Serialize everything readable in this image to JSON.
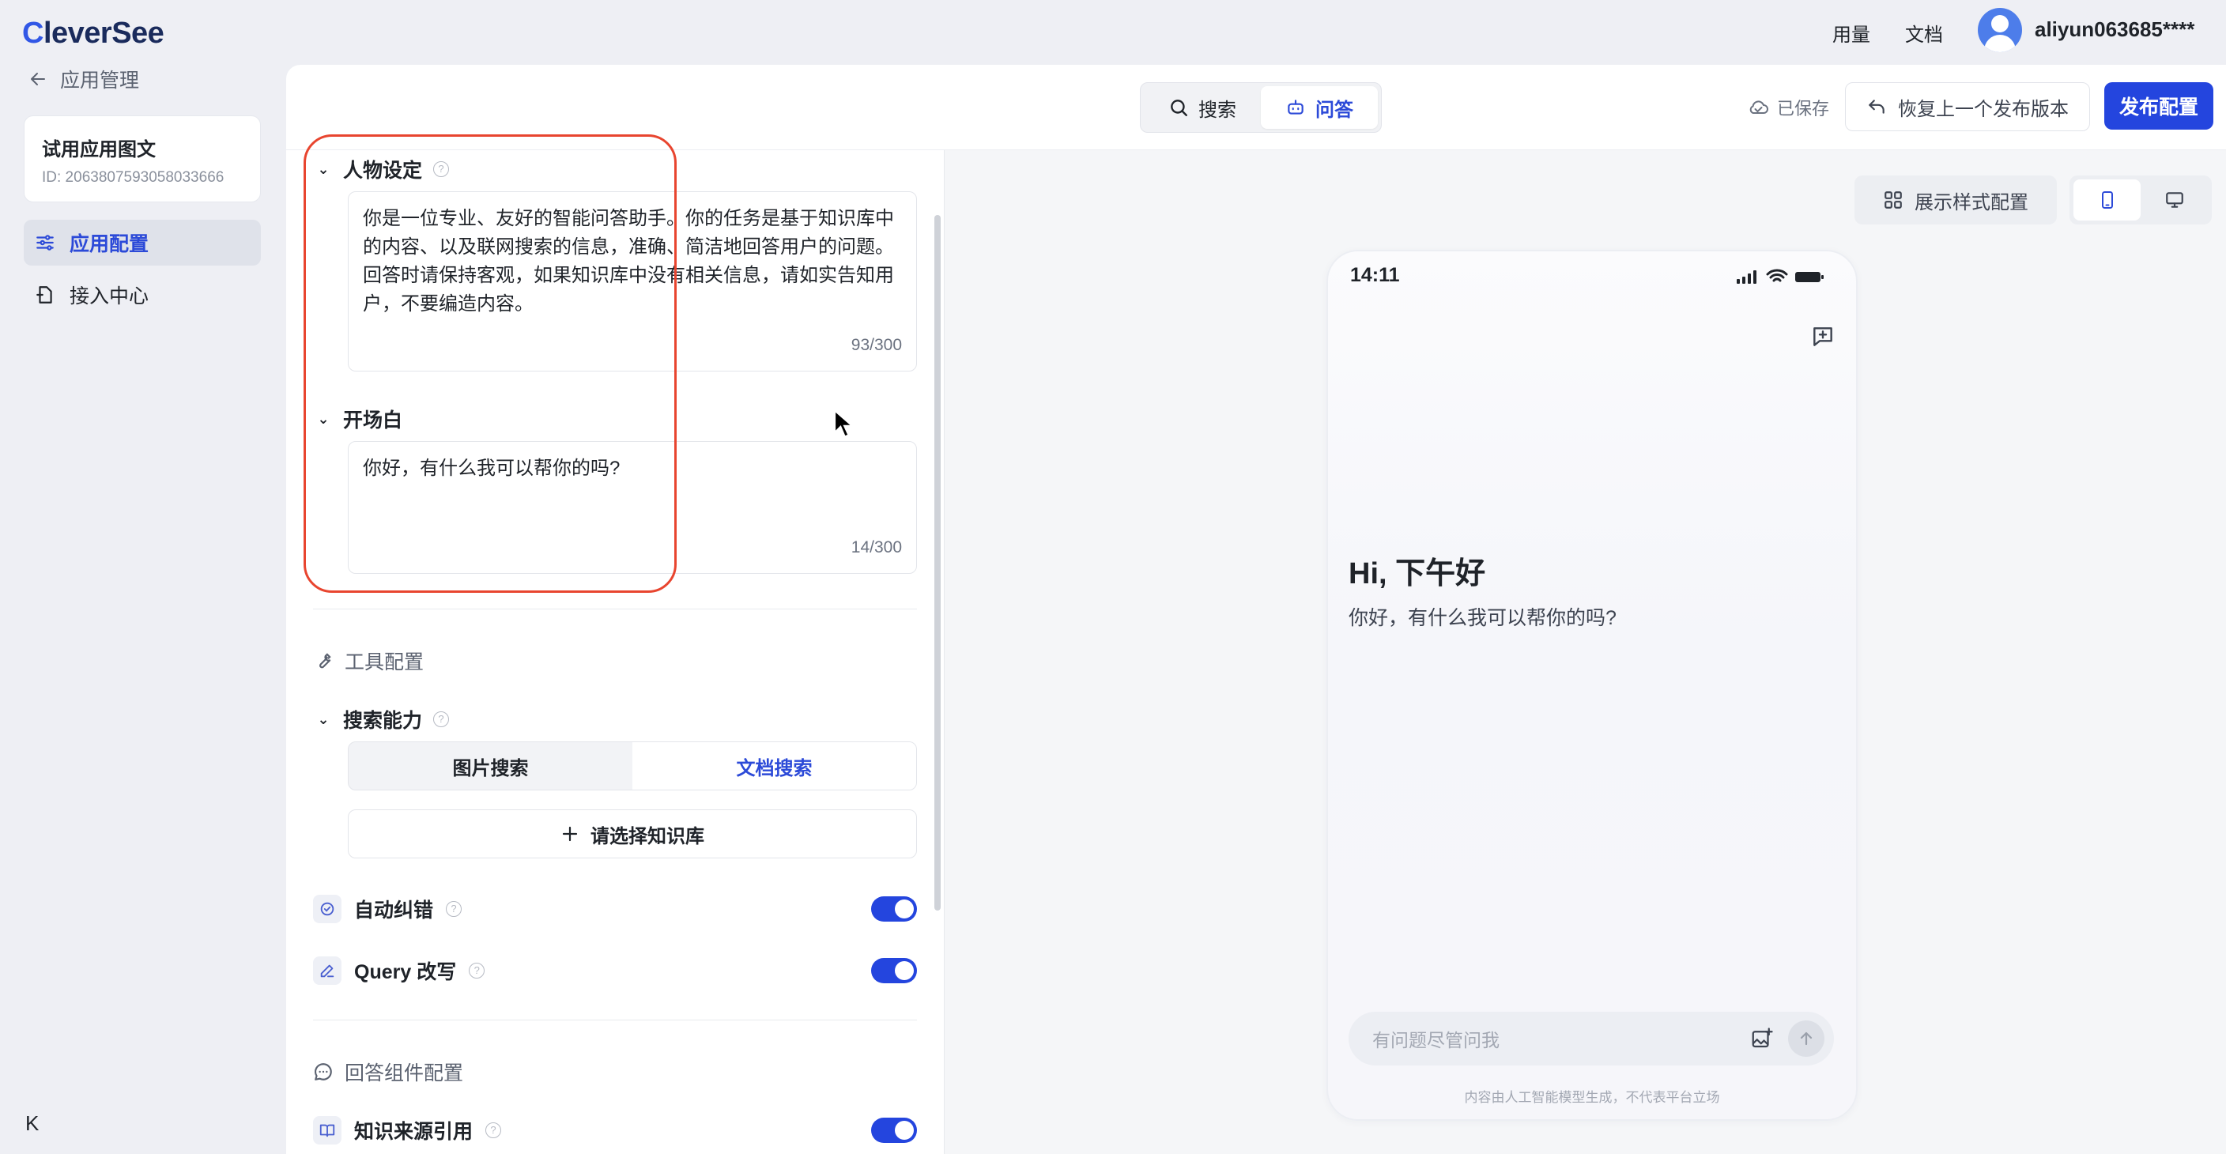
{
  "brand": {
    "logo_text": "leverSee",
    "logo_letter": "C"
  },
  "header": {
    "usage": "用量",
    "docs": "文档",
    "username": "aliyun063685****"
  },
  "nav": {
    "back_label": "应用管理",
    "app_name": "试用应用图文",
    "app_id": "ID: 2063807593058033666",
    "items": [
      {
        "label": "应用配置",
        "active": true
      },
      {
        "label": "接入中心",
        "active": false
      }
    ],
    "collapse_icon": "K"
  },
  "topbar": {
    "modes": [
      {
        "label": "搜索",
        "active": false
      },
      {
        "label": "问答",
        "active": true
      }
    ],
    "saved": "已保存",
    "restore": "恢复上一个发布版本",
    "publish": "发布配置"
  },
  "config": {
    "persona": {
      "title": "人物设定",
      "text": "你是一位专业、友好的智能问答助手。你的任务是基于知识库中的内容、以及联网搜索的信息，准确、简洁地回答用户的问题。回答时请保持客观，如果知识库中没有相关信息，请如实告知用户，不要编造内容。",
      "counter": "93/300"
    },
    "opening": {
      "title": "开场白",
      "text": "你好，有什么我可以帮你的吗?",
      "counter": "14/300"
    },
    "tools_title": "工具配置",
    "search": {
      "title": "搜索能力",
      "tabs": [
        {
          "label": "图片搜索",
          "active": false
        },
        {
          "label": "文档搜索",
          "active": true
        }
      ],
      "kb_button": "请选择知识库"
    },
    "toggles": [
      {
        "label": "自动纠错",
        "on": true
      },
      {
        "label": "Query 改写",
        "on": true
      }
    ],
    "answer_title": "回答组件配置",
    "answer_toggles": [
      {
        "label": "知识来源引用",
        "on": true
      }
    ]
  },
  "preview": {
    "style_button": "展示样式配置",
    "time": "14:11",
    "greeting": "Hi, 下午好",
    "greeting_sub": "你好，有什么我可以帮你的吗?",
    "input_placeholder": "有问题尽管问我",
    "disclaimer": "内容由人工智能模型生成，不代表平台立场"
  },
  "colors": {
    "accent": "#2445de",
    "annotation": "#e8452f"
  }
}
